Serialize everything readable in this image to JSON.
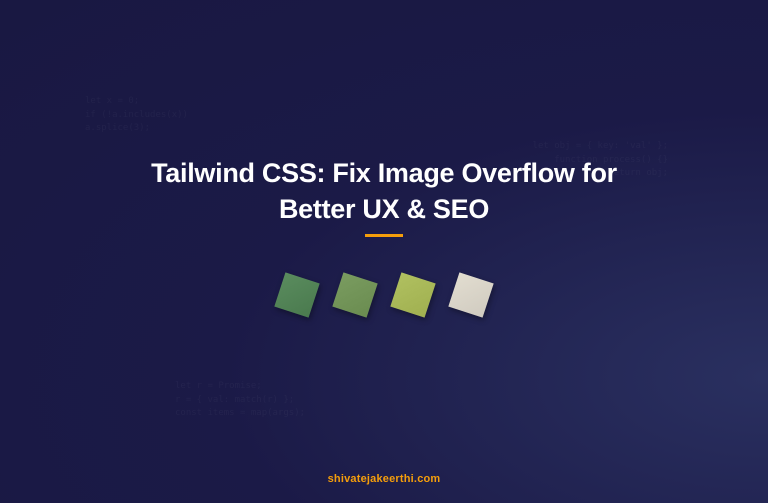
{
  "title": "Tailwind CSS: Fix Image Overflow for\nBetter UX & SEO",
  "footer": "shivatejakeerthi.com",
  "tiles": [
    {
      "color": "#5a8c5e"
    },
    {
      "color": "#7a9c60"
    },
    {
      "color": "#b0c060"
    },
    {
      "color": "#e2ddd0"
    }
  ],
  "colors": {
    "accent": "#f59e0b",
    "background": "#1b1a47"
  },
  "codeSnippets": {
    "one": "let x = 0;\nif (!a.includes(x))\na.splice(3);",
    "two": "let obj = { key: 'val' };\nfunction process() {}\nreturn obj;",
    "three": "let r = Promise;\nr = { val: match(r) };\nconst items = map(args);"
  }
}
